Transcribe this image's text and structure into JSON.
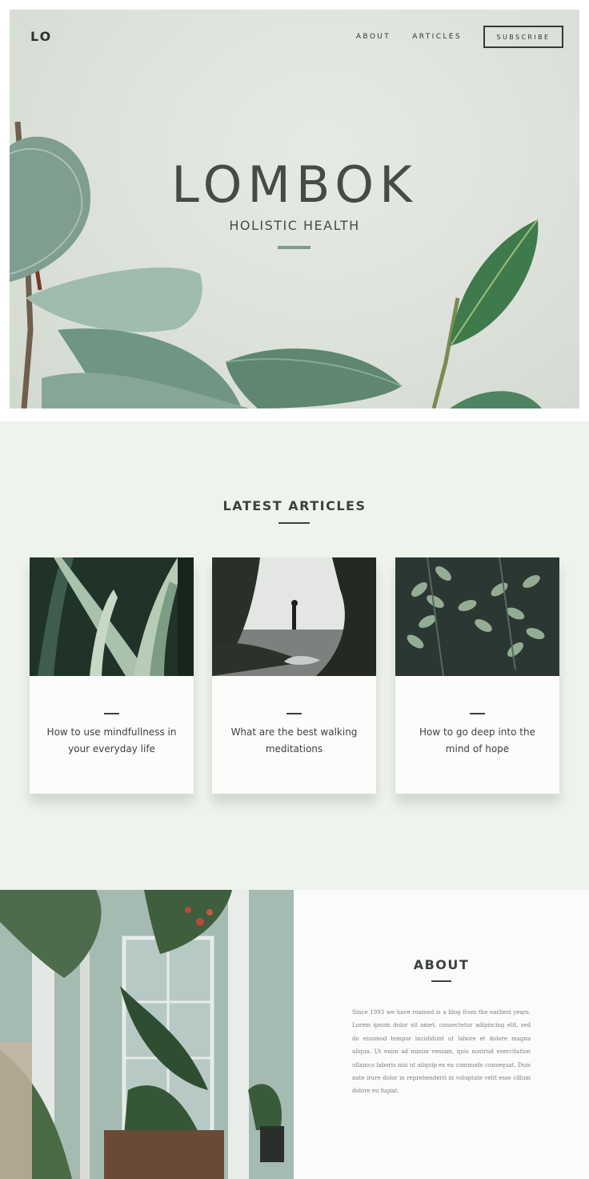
{
  "header": {
    "logo": "LO",
    "nav": [
      {
        "label": "ABOUT"
      },
      {
        "label": "ARTICLES"
      }
    ],
    "subscribe_label": "SUBSCRIBE"
  },
  "hero": {
    "title": "LOMBOK",
    "subtitle": "HOLISTIC HEALTH"
  },
  "articles": {
    "title": "LATEST ARTICLES",
    "items": [
      {
        "title": "How to use mindfullness in your everyday life"
      },
      {
        "title": "What are the best walking meditations"
      },
      {
        "title": "How to go deep into the mind of hope"
      }
    ]
  },
  "about": {
    "title": "ABOUT",
    "text": "Since 1993 we have roamed is a blog from the earliest years. Lorem ipsum dolor sit amet, consectetur adipiscing elit, sed do eiusmod tempor incididunt ut labore et dolore magna aliqua. Ut enim ad minim veniam, quis nostrud exercitation ullamco laboris nisi ut aliquip ex ea commodo consequat. Duis aute irure dolor in reprehenderit in voluptate velit esse cillum dolore eu fugiat."
  },
  "colors": {
    "hero_bg": "#dce2da",
    "articles_bg": "#eef3ec",
    "accent_rule": "#7f9a8e",
    "text_dark": "#3c413e"
  }
}
